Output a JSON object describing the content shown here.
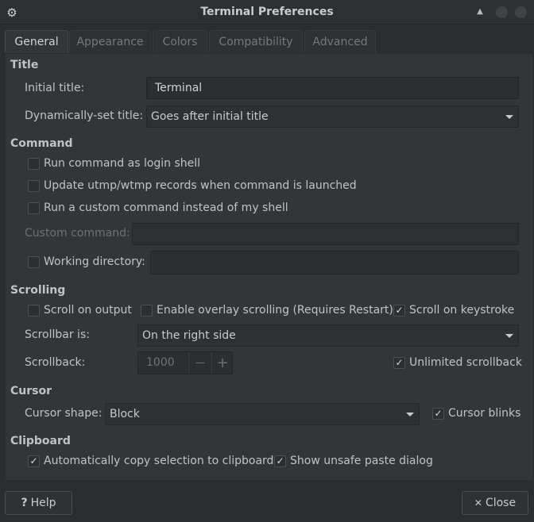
{
  "window": {
    "title": "Terminal Preferences",
    "icon": "gear-icon",
    "controls": {
      "rollup_icon": "▲"
    }
  },
  "tabs": [
    {
      "label": "General",
      "active": true
    },
    {
      "label": "Appearance",
      "active": false
    },
    {
      "label": "Colors",
      "active": false
    },
    {
      "label": "Compatibility",
      "active": false
    },
    {
      "label": "Advanced",
      "active": false
    }
  ],
  "title_section": {
    "heading": "Title",
    "initial_title_label": "Initial title:",
    "initial_title_value": "Terminal",
    "dynamic_title_label": "Dynamically-set title:",
    "dynamic_title_value": "Goes after initial title"
  },
  "command_section": {
    "heading": "Command",
    "login_shell": {
      "label": "Run command as login shell",
      "checked": false
    },
    "utmp": {
      "label": "Update utmp/wtmp records when command is launched",
      "checked": false
    },
    "custom_cmd": {
      "label": "Run a custom command instead of my shell",
      "checked": false
    },
    "custom_command_label": "Custom command:",
    "custom_command_value": "",
    "working_dir": {
      "label": "Working directory:",
      "checked": false
    },
    "working_dir_value": ""
  },
  "scrolling_section": {
    "heading": "Scrolling",
    "scroll_on_output": {
      "label": "Scroll on output",
      "checked": false
    },
    "overlay_scrolling": {
      "label": "Enable overlay scrolling (Requires Restart)",
      "checked": false
    },
    "scroll_on_keystroke": {
      "label": "Scroll on keystroke",
      "checked": true
    },
    "scrollbar_label": "Scrollbar is:",
    "scrollbar_value": "On the right side",
    "scrollback_label": "Scrollback:",
    "scrollback_value": "1000",
    "minus": "—",
    "plus": "+",
    "unlimited": {
      "label": "Unlimited scrollback",
      "checked": true
    }
  },
  "cursor_section": {
    "heading": "Cursor",
    "shape_label": "Cursor shape:",
    "shape_value": "Block",
    "blinks": {
      "label": "Cursor blinks",
      "checked": true
    }
  },
  "clipboard_section": {
    "heading": "Clipboard",
    "auto_copy": {
      "label": "Automatically copy selection to clipboard",
      "checked": true
    },
    "unsafe_paste": {
      "label": "Show unsafe paste dialog",
      "checked": true
    }
  },
  "buttons": {
    "help_icon": "?",
    "help_label": "Help",
    "close_icon": "✕",
    "close_label": "Close"
  },
  "check_glyph": "✓",
  "colors": {
    "background": "#2b2e30",
    "panel": "#333638",
    "text": "#c8cacb",
    "dim_text": "#6d7174"
  }
}
